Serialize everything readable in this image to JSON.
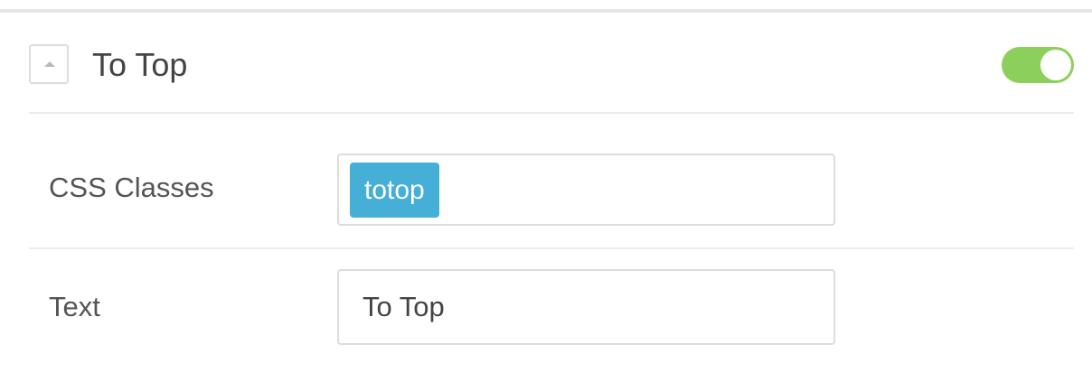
{
  "panel": {
    "title": "To Top",
    "enabled": true,
    "colors": {
      "toggle_on": "#8dcf5c",
      "tag_background": "#45afd8"
    }
  },
  "icons": {
    "collapse": "caret-up-icon"
  },
  "fields": {
    "css_classes": {
      "label": "CSS Classes",
      "tags": [
        "totop"
      ]
    },
    "text": {
      "label": "Text",
      "value": "To Top"
    }
  }
}
